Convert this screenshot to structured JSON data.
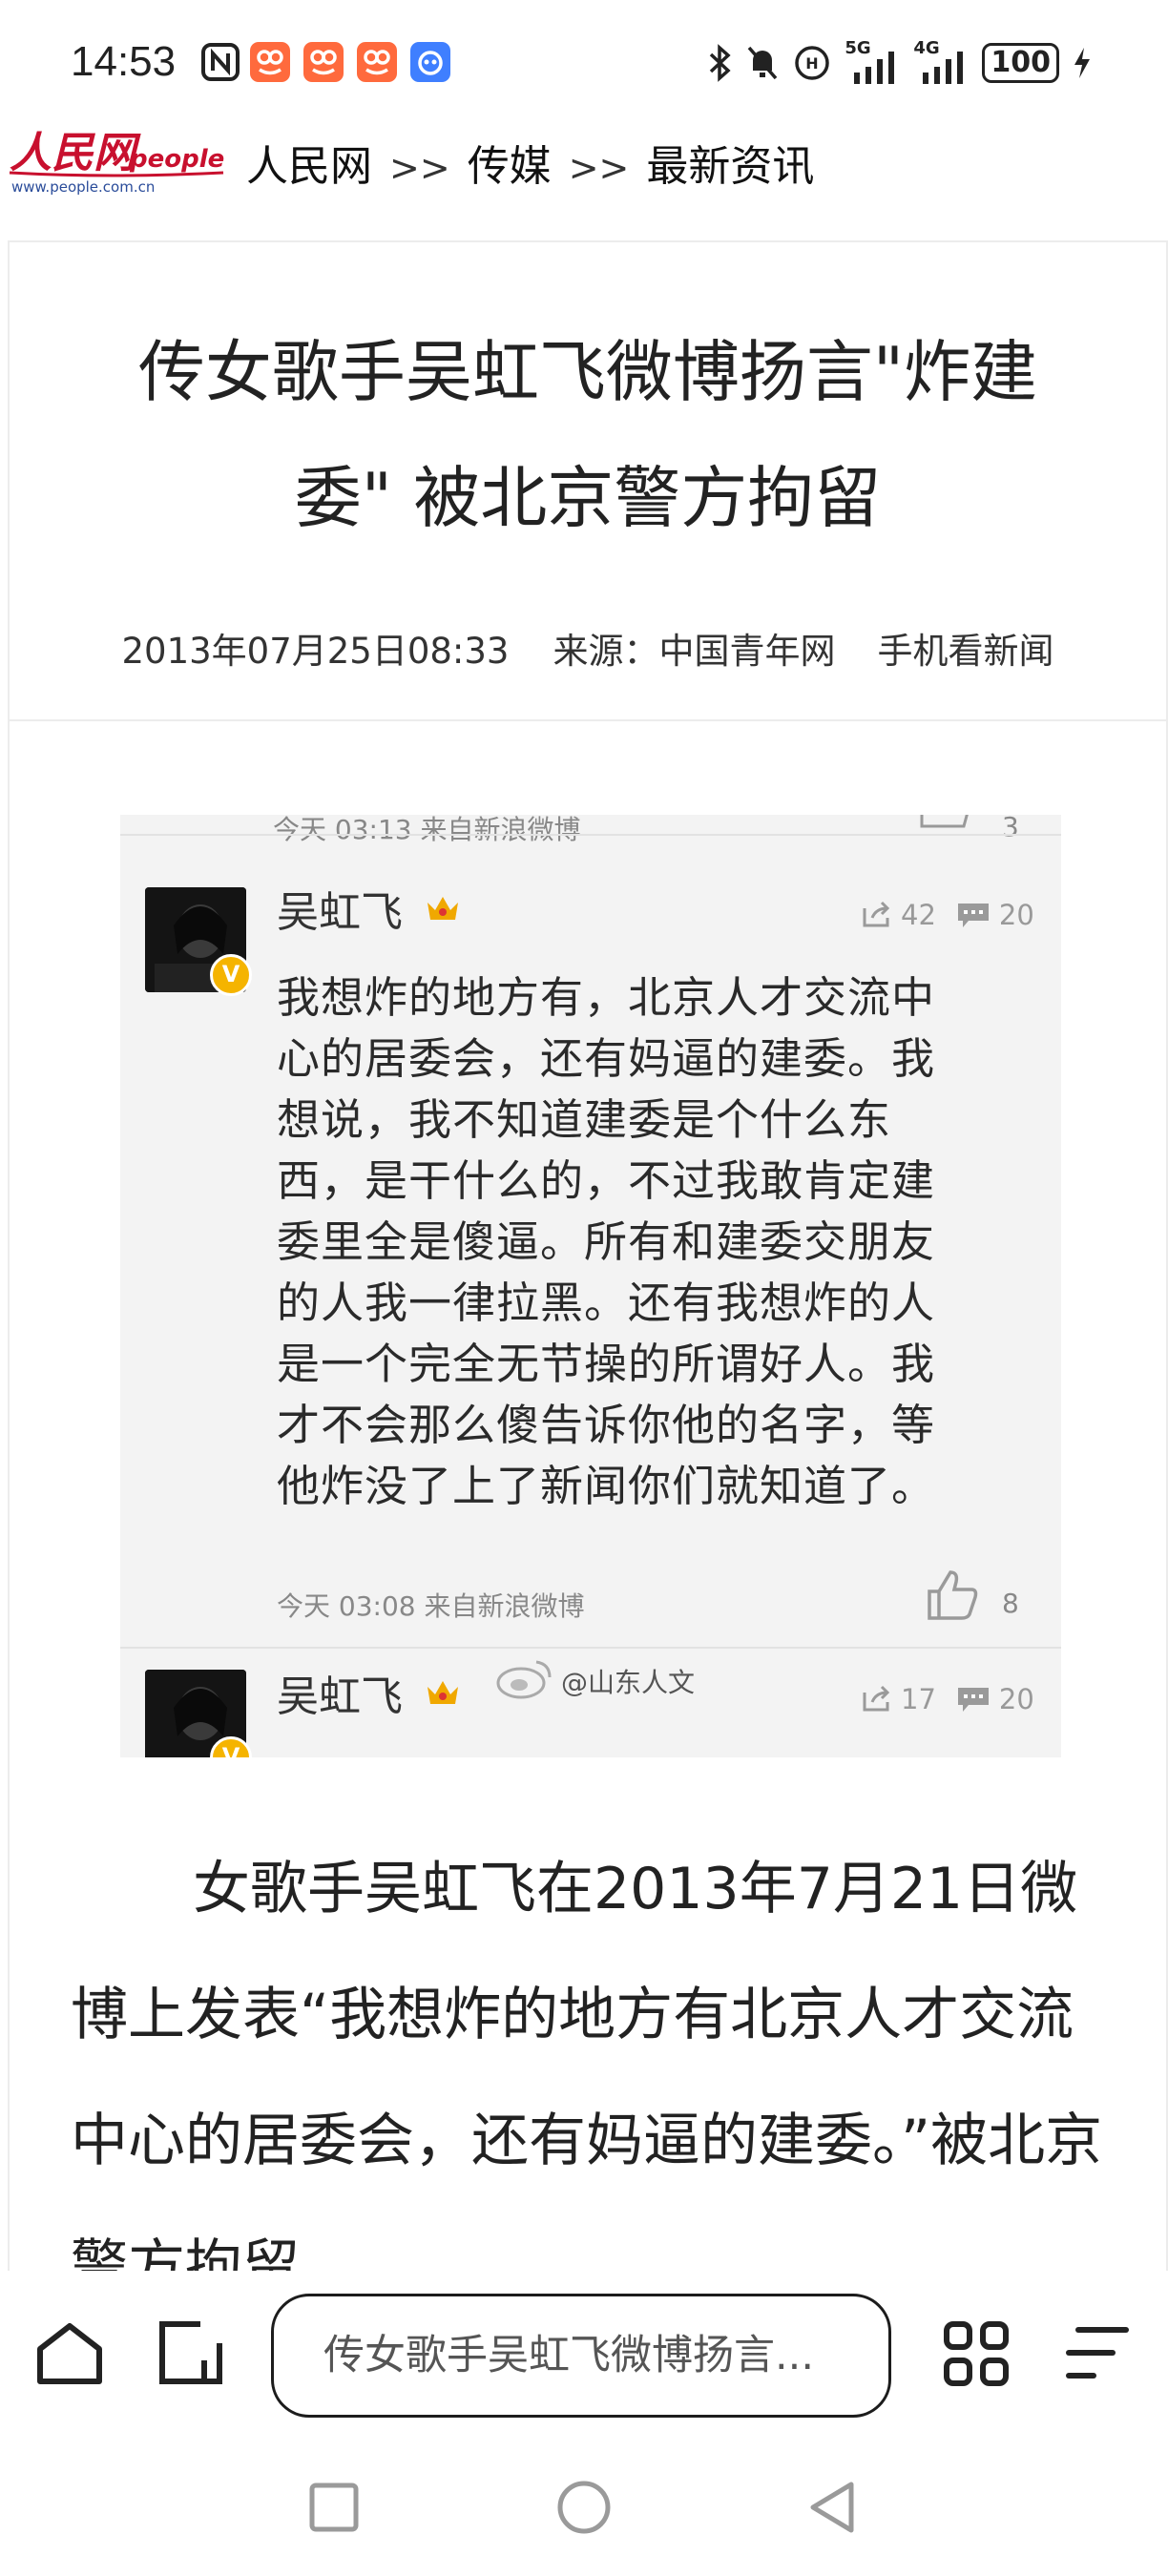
{
  "status_bar": {
    "time": "14:53",
    "battery": "100",
    "network_labels": [
      "5G",
      "4G"
    ]
  },
  "breadcrumb": {
    "site": "人民网",
    "section": "传媒",
    "subsection": "最新资讯",
    "separator": ">>",
    "logo_text": "人民网",
    "logo_sub": "people",
    "logo_url": "www.people.com.cn"
  },
  "article": {
    "title_line1": "传女歌手吴虹飞微博扬言\"炸建",
    "title_line2": "委\" 被北京警方拘留",
    "date": "2013年07月25日08:33",
    "source_label": "来源：",
    "source": "中国青年网",
    "mobile_link": "手机看新闻",
    "body": "女歌手吴虹飞在2013年7月21日微博上发表“我想炸的地方有北京人才交流中心的居委会，还有妈逼的建委。”被北京警方拘留。"
  },
  "screenshot": {
    "top_meta": "今天 03:13  来自新浪微博",
    "top_like": "3",
    "user": "吴虹飞",
    "repost_count": "42",
    "comment_count": "20",
    "post_lines": [
      "我想炸的地方有，北京人才交流中",
      "心的居委会，还有妈逼的建委。我",
      "想说，我不知道建委是个什么东",
      "西，是干什么的，不过我敢肯定建",
      "委里全是傻逼。所有和建委交朋友",
      "的人我一律拉黑。还有我想炸的人",
      "是一个完全无节操的所谓好人。我",
      "才不会那么傻告诉你他的名字，等",
      "他炸没了上了新闻你们就知道了。"
    ],
    "post_meta": "今天 03:08  来自新浪微博",
    "like_count": "8",
    "user2": "吴虹飞",
    "watermark": "@山东人文",
    "repost_count2": "17",
    "comment_count2": "20"
  },
  "bottom_bar": {
    "search_text": "传女歌手吴虹飞微博扬言..."
  },
  "colors": {
    "accent_red": "#c8102e",
    "app_orange": "#ff6a3d",
    "app_blue": "#3f7fff"
  }
}
